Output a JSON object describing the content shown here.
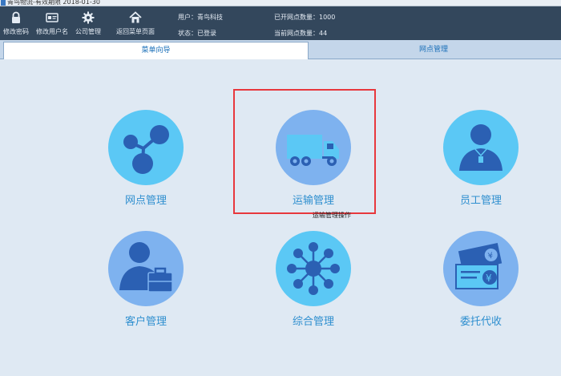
{
  "window": {
    "title": "青鸟物流-有效期限 2018-01-30"
  },
  "toolbar": {
    "buttons": [
      {
        "label": "修改密码",
        "icon": "lock-icon"
      },
      {
        "label": "修改用户名",
        "icon": "id-card-icon"
      },
      {
        "label": "公司管理",
        "icon": "gear-icon"
      },
      {
        "label": "返回菜单页面",
        "icon": "home-icon"
      }
    ],
    "user_line": "用户：青鸟科技",
    "status_line": "状态：已登录",
    "count_opened": "已开网点数量：1000",
    "count_current": "当前网点数量：44"
  },
  "tabs": [
    {
      "label": "菜单向导",
      "active": true
    },
    {
      "label": "网点管理",
      "active": false
    }
  ],
  "menu": [
    {
      "label": "网点管理",
      "icon": "network-nodes-icon"
    },
    {
      "label": "运输管理",
      "icon": "truck-icon"
    },
    {
      "label": "员工管理",
      "icon": "employee-icon"
    },
    {
      "label": "客户管理",
      "icon": "customer-icon"
    },
    {
      "label": "综合管理",
      "icon": "hub-icon"
    },
    {
      "label": "委托代收",
      "icon": "cash-collect-icon"
    }
  ],
  "tooltip": "运输管理操作",
  "colors": {
    "toolbar_bg": "#33475c",
    "content_bg": "#dfe9f3",
    "circle_light": "#5bc8f5",
    "circle_medium": "#7eb2ef",
    "icon_dark": "#2b60b3",
    "label_blue": "#2f8fcf",
    "highlight_red": "#e8383d"
  }
}
